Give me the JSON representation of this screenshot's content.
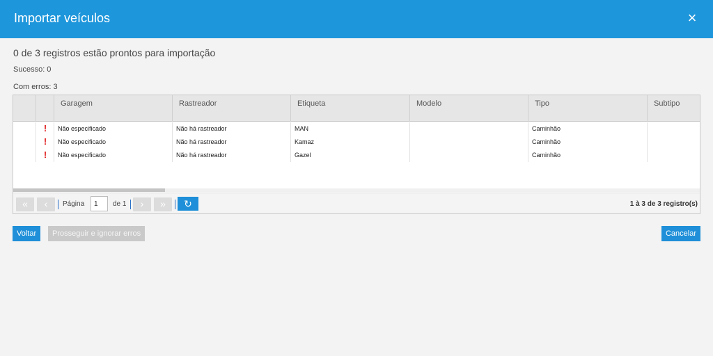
{
  "dialog": {
    "title": "Importar veículos",
    "close_icon": "×"
  },
  "summary": "0 de 3 registros estão prontos para importação",
  "success": "Sucesso: 0",
  "errors": "Com erros: 3",
  "grid": {
    "columns": [
      "Garagem",
      "Rastreador",
      "Etiqueta",
      "Modelo",
      "Tipo",
      "Subtipo"
    ],
    "rows": [
      {
        "error": "!",
        "garagem": "Não especificado",
        "rastreador": "Não há rastreador",
        "etiqueta": "MAN",
        "modelo": "",
        "tipo": "Caminhão",
        "subtipo": ""
      },
      {
        "error": "!",
        "garagem": "Não especificado",
        "rastreador": "Não há rastreador",
        "etiqueta": "Kamaz",
        "modelo": "",
        "tipo": "Caminhão",
        "subtipo": ""
      },
      {
        "error": "!",
        "garagem": "Não especificado",
        "rastreador": "Não há rastreador",
        "etiqueta": "Gazel",
        "modelo": "",
        "tipo": "Caminhão",
        "subtipo": ""
      }
    ]
  },
  "pager": {
    "first": "«",
    "prev": "‹",
    "page_label": "Página",
    "page_value": "1",
    "of_label": "de 1",
    "next": "›",
    "last": "»",
    "refresh": "↻",
    "info": "1 à 3 de 3 registro(s)"
  },
  "buttons": {
    "back": "Voltar",
    "proceed": "Prosseguir e ignorar erros",
    "cancel": "Cancelar"
  }
}
